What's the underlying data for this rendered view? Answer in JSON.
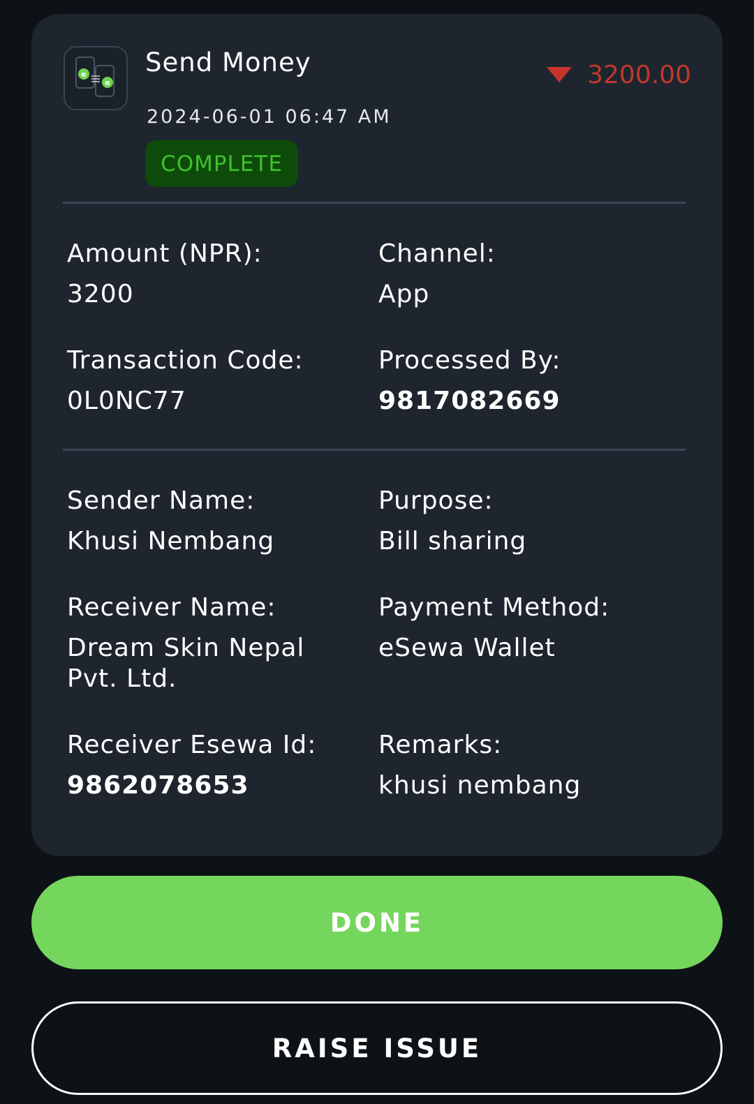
{
  "transaction": {
    "title": "Send Money",
    "amount": "3200.00",
    "datetime": "2024-06-01 06:47 AM",
    "status": "COMPLETE",
    "direction_icon": "caret-down-icon"
  },
  "details_primary": {
    "amount_label": "Amount (NPR):",
    "amount_value": "3200",
    "channel_label": "Channel:",
    "channel_value": "App",
    "code_label": "Transaction Code:",
    "code_value": "0L0NC77",
    "processed_label": "Processed By:",
    "processed_value": "9817082669"
  },
  "details_secondary": {
    "sender_label": "Sender Name:",
    "sender_value": "Khusi Nembang",
    "purpose_label": "Purpose:",
    "purpose_value": "Bill sharing",
    "receiver_label": "Receiver Name:",
    "receiver_value": "Dream Skin Nepal Pvt. Ltd.",
    "method_label": "Payment Method:",
    "method_value": "eSewa Wallet",
    "receiver_id_label": "Receiver Esewa Id:",
    "receiver_id_value": "9862078653",
    "remarks_label": "Remarks:",
    "remarks_value": "khusi nembang"
  },
  "actions": {
    "done_label": "DONE",
    "raise_issue_label": "RAISE ISSUE"
  },
  "colors": {
    "background": "#0d1217",
    "card": "#1e252e",
    "debit_amount": "#c0392b",
    "status_bg": "#0e4a0a",
    "status_text": "#3fc02e",
    "done_button": "#75d65d"
  }
}
